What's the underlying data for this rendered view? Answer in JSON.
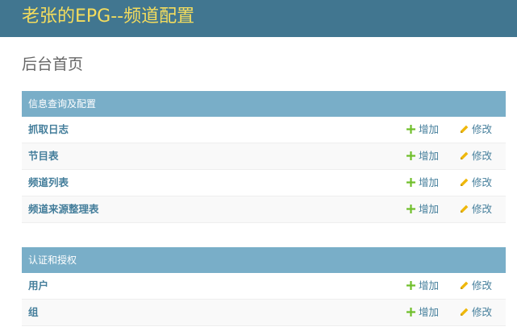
{
  "header": {
    "brand": "老张的EPG--频道配置"
  },
  "page": {
    "title": "后台首页"
  },
  "modules": [
    {
      "caption": "信息查询及配置",
      "rows": [
        {
          "label": "抓取日志",
          "add": "增加",
          "change": "修改"
        },
        {
          "label": "节目表",
          "add": "增加",
          "change": "修改"
        },
        {
          "label": "频道列表",
          "add": "增加",
          "change": "修改"
        },
        {
          "label": "频道来源整理表",
          "add": "增加",
          "change": "修改"
        }
      ]
    },
    {
      "caption": "认证和授权",
      "rows": [
        {
          "label": "用户",
          "add": "增加",
          "change": "修改"
        },
        {
          "label": "组",
          "add": "增加",
          "change": "修改"
        }
      ]
    }
  ],
  "icons": {
    "add": "plus-icon",
    "change": "pencil-icon"
  },
  "colors": {
    "header_bg": "#417690",
    "brand_text": "#f5dd5d",
    "caption_bg": "#79aec8",
    "link": "#447e9b",
    "add_icon": "#70bf2b",
    "change_icon": "#efb80b"
  }
}
